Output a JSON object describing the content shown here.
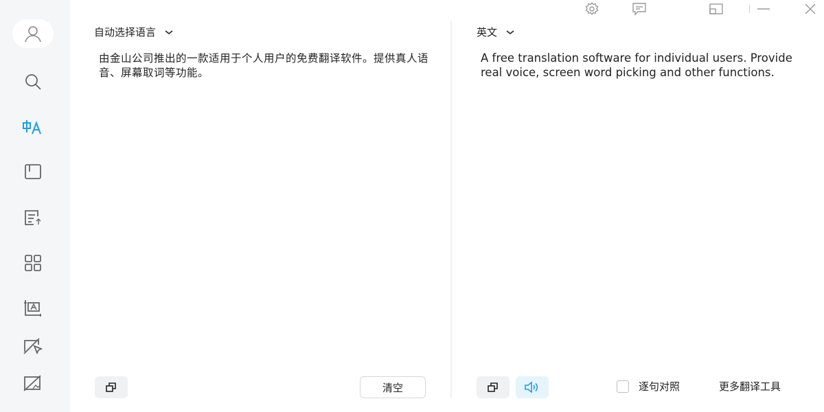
{
  "titlebar": {
    "icons": [
      "settings-icon",
      "feedback-icon",
      "mini-mode-icon",
      "minimize-icon",
      "close-icon"
    ]
  },
  "sidebar": {
    "items": [
      "search-icon",
      "translate-icon",
      "wordbook-icon",
      "doc-translate-icon",
      "apps-icon",
      "screenshot-translate-icon",
      "word-picking-icon",
      "disable-picking-icon"
    ],
    "active": "translate-icon",
    "accent": "#1a9ee6"
  },
  "source": {
    "language": "自动选择语言",
    "text": "由金山公司推出的一款适用于个人用户的免费翻译软件。提供真人语音、屏幕取词等功能。",
    "clear_label": "清空"
  },
  "target": {
    "language": "英文",
    "text": "A free translation software for individual users. Provide real voice, screen word picking and other functions.",
    "sentence_compare_label": "逐句对照",
    "more_tools_label": "更多翻译工具"
  }
}
